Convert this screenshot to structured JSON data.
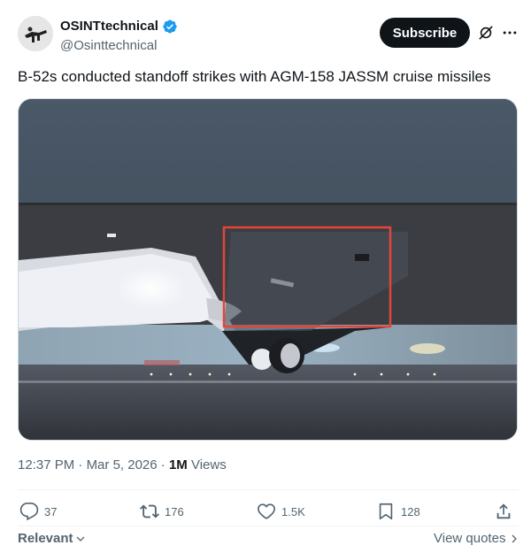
{
  "author": {
    "display_name": "OSINTtechnical",
    "handle": "@Osinttechnical",
    "verified": true
  },
  "header": {
    "subscribe_label": "Subscribe",
    "grok_icon": "grok-icon",
    "more_icon": "more-icon"
  },
  "tweet": {
    "text": "B-52s conducted standoff strikes with AGM-158 JASSM cruise missiles"
  },
  "media": {
    "type": "video-still",
    "description_icon": "aircraft-video",
    "highlight_color": "#e2463b"
  },
  "meta": {
    "time": "12:37 PM",
    "separator": "·",
    "date": "Mar 5, 2026",
    "views_count": "1M",
    "views_label": "Views"
  },
  "actions": {
    "reply_count": "37",
    "retweet_count": "176",
    "like_count": "1.5K",
    "bookmark_count": "128"
  },
  "footer": {
    "relevant_label": "Relevant",
    "view_quotes_label": "View quotes"
  },
  "colors": {
    "text_primary": "#0f1419",
    "text_secondary": "#536471",
    "verified_blue": "#1d9bf0",
    "button_dark": "#0f1419"
  }
}
